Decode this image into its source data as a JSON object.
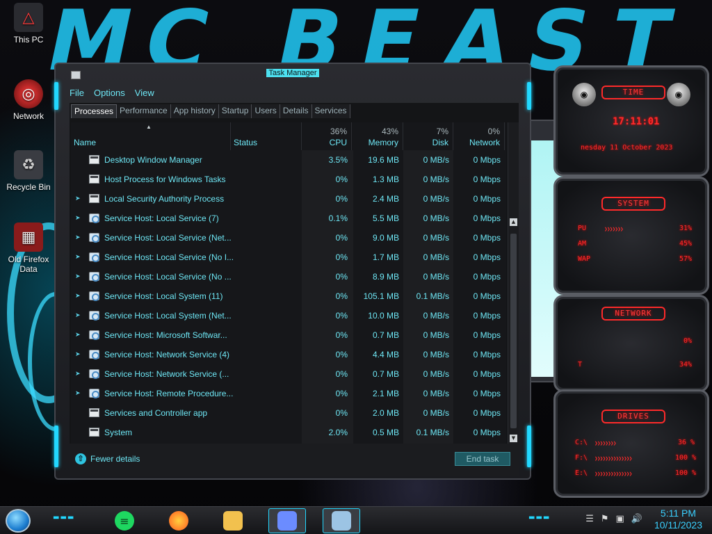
{
  "desktop": {
    "icons": [
      {
        "label": "This PC",
        "icon": "computer-icon"
      },
      {
        "label": "Network",
        "icon": "network-icon"
      },
      {
        "label": "Recycle Bin",
        "icon": "recycle-bin-icon"
      },
      {
        "label": "Old Firefox Data",
        "icon": "folder-icon"
      }
    ],
    "wallpaper_text": "MC BEAST"
  },
  "task_manager": {
    "title": "Task Manager",
    "menu": [
      "File",
      "Options",
      "View"
    ],
    "tabs": [
      "Processes",
      "Performance",
      "App history",
      "Startup",
      "Users",
      "Details",
      "Services"
    ],
    "active_tab": "Processes",
    "columns": {
      "name": "Name",
      "status": "Status",
      "cpu": {
        "label": "CPU",
        "pct": "36%"
      },
      "memory": {
        "label": "Memory",
        "pct": "43%"
      },
      "disk": {
        "label": "Disk",
        "pct": "7%"
      },
      "network": {
        "label": "Network",
        "pct": "0%"
      }
    },
    "processes": [
      {
        "name": "Desktop Window Manager",
        "cpu": "3.5%",
        "memory": "19.6 MB",
        "disk": "0 MB/s",
        "network": "0 Mbps",
        "expandable": false,
        "icon": "window-icon"
      },
      {
        "name": "Host Process for Windows Tasks",
        "cpu": "0%",
        "memory": "1.3 MB",
        "disk": "0 MB/s",
        "network": "0 Mbps",
        "expandable": false,
        "icon": "window-icon"
      },
      {
        "name": "Local Security Authority Process",
        "cpu": "0%",
        "memory": "2.4 MB",
        "disk": "0 MB/s",
        "network": "0 Mbps",
        "expandable": true,
        "icon": "window-icon"
      },
      {
        "name": "Service Host: Local Service (7)",
        "cpu": "0.1%",
        "memory": "5.5 MB",
        "disk": "0 MB/s",
        "network": "0 Mbps",
        "expandable": true,
        "icon": "gear-icon"
      },
      {
        "name": "Service Host: Local Service (Net...",
        "cpu": "0%",
        "memory": "9.0 MB",
        "disk": "0 MB/s",
        "network": "0 Mbps",
        "expandable": true,
        "icon": "gear-icon"
      },
      {
        "name": "Service Host: Local Service (No I...",
        "cpu": "0%",
        "memory": "1.7 MB",
        "disk": "0 MB/s",
        "network": "0 Mbps",
        "expandable": true,
        "icon": "gear-icon"
      },
      {
        "name": "Service Host: Local Service (No ...",
        "cpu": "0%",
        "memory": "8.9 MB",
        "disk": "0 MB/s",
        "network": "0 Mbps",
        "expandable": true,
        "icon": "gear-icon"
      },
      {
        "name": "Service Host: Local System (11)",
        "cpu": "0%",
        "memory": "105.1 MB",
        "disk": "0.1 MB/s",
        "network": "0 Mbps",
        "expandable": true,
        "icon": "gear-icon"
      },
      {
        "name": "Service Host: Local System (Net...",
        "cpu": "0%",
        "memory": "10.0 MB",
        "disk": "0 MB/s",
        "network": "0 Mbps",
        "expandable": true,
        "icon": "gear-icon"
      },
      {
        "name": "Service Host: Microsoft Softwar...",
        "cpu": "0%",
        "memory": "0.7 MB",
        "disk": "0 MB/s",
        "network": "0 Mbps",
        "expandable": true,
        "icon": "gear-icon"
      },
      {
        "name": "Service Host: Network Service (4)",
        "cpu": "0%",
        "memory": "4.4 MB",
        "disk": "0 MB/s",
        "network": "0 Mbps",
        "expandable": true,
        "icon": "gear-icon"
      },
      {
        "name": "Service Host: Network Service (...",
        "cpu": "0%",
        "memory": "0.7 MB",
        "disk": "0 MB/s",
        "network": "0 Mbps",
        "expandable": true,
        "icon": "gear-icon"
      },
      {
        "name": "Service Host: Remote Procedure...",
        "cpu": "0%",
        "memory": "2.1 MB",
        "disk": "0 MB/s",
        "network": "0 Mbps",
        "expandable": true,
        "icon": "gear-icon"
      },
      {
        "name": "Services and Controller app",
        "cpu": "0%",
        "memory": "2.0 MB",
        "disk": "0 MB/s",
        "network": "0 Mbps",
        "expandable": false,
        "icon": "window-icon"
      },
      {
        "name": "System",
        "cpu": "2.0%",
        "memory": "0.5 MB",
        "disk": "0.1 MB/s",
        "network": "0 Mbps",
        "expandable": false,
        "icon": "window-icon"
      }
    ],
    "fewer_details": "Fewer details",
    "end_task": "End task"
  },
  "gadgets": {
    "time": {
      "title": "TIME",
      "clock": "17:11:01",
      "date": "nesday 11 October 2023"
    },
    "system": {
      "title": "SYSTEM",
      "rows": [
        {
          "label": "PU",
          "value": "31%"
        },
        {
          "label": "AM",
          "value": "45%"
        },
        {
          "label": "WAP",
          "value": "57%"
        }
      ]
    },
    "network": {
      "title": "NETWORK",
      "rows": [
        {
          "label": "",
          "value": "0%"
        },
        {
          "label": "T",
          "value": "34%"
        }
      ]
    },
    "drives": {
      "title": "DRIVES",
      "rows": [
        {
          "label": "C:\\",
          "value": "36 %"
        },
        {
          "label": "F:\\",
          "value": "100 %"
        },
        {
          "label": "E:\\",
          "value": "100 %"
        }
      ]
    }
  },
  "taskbar": {
    "apps": [
      {
        "icon": "spotify-icon",
        "color": "#1ed760"
      },
      {
        "icon": "firefox-icon",
        "color": "#ff7a18"
      },
      {
        "icon": "file-explorer-icon",
        "color": "#f2c14e"
      },
      {
        "icon": "control-panel-icon",
        "color": "#6b8cff"
      },
      {
        "icon": "task-manager-icon",
        "color": "#9cc4e4"
      }
    ],
    "time": "5:11 PM",
    "date": "10/11/2023"
  },
  "colors": {
    "accent": "#22d8ff",
    "text": "#6ee7f5",
    "gadget_red": "#ff2a2a"
  }
}
